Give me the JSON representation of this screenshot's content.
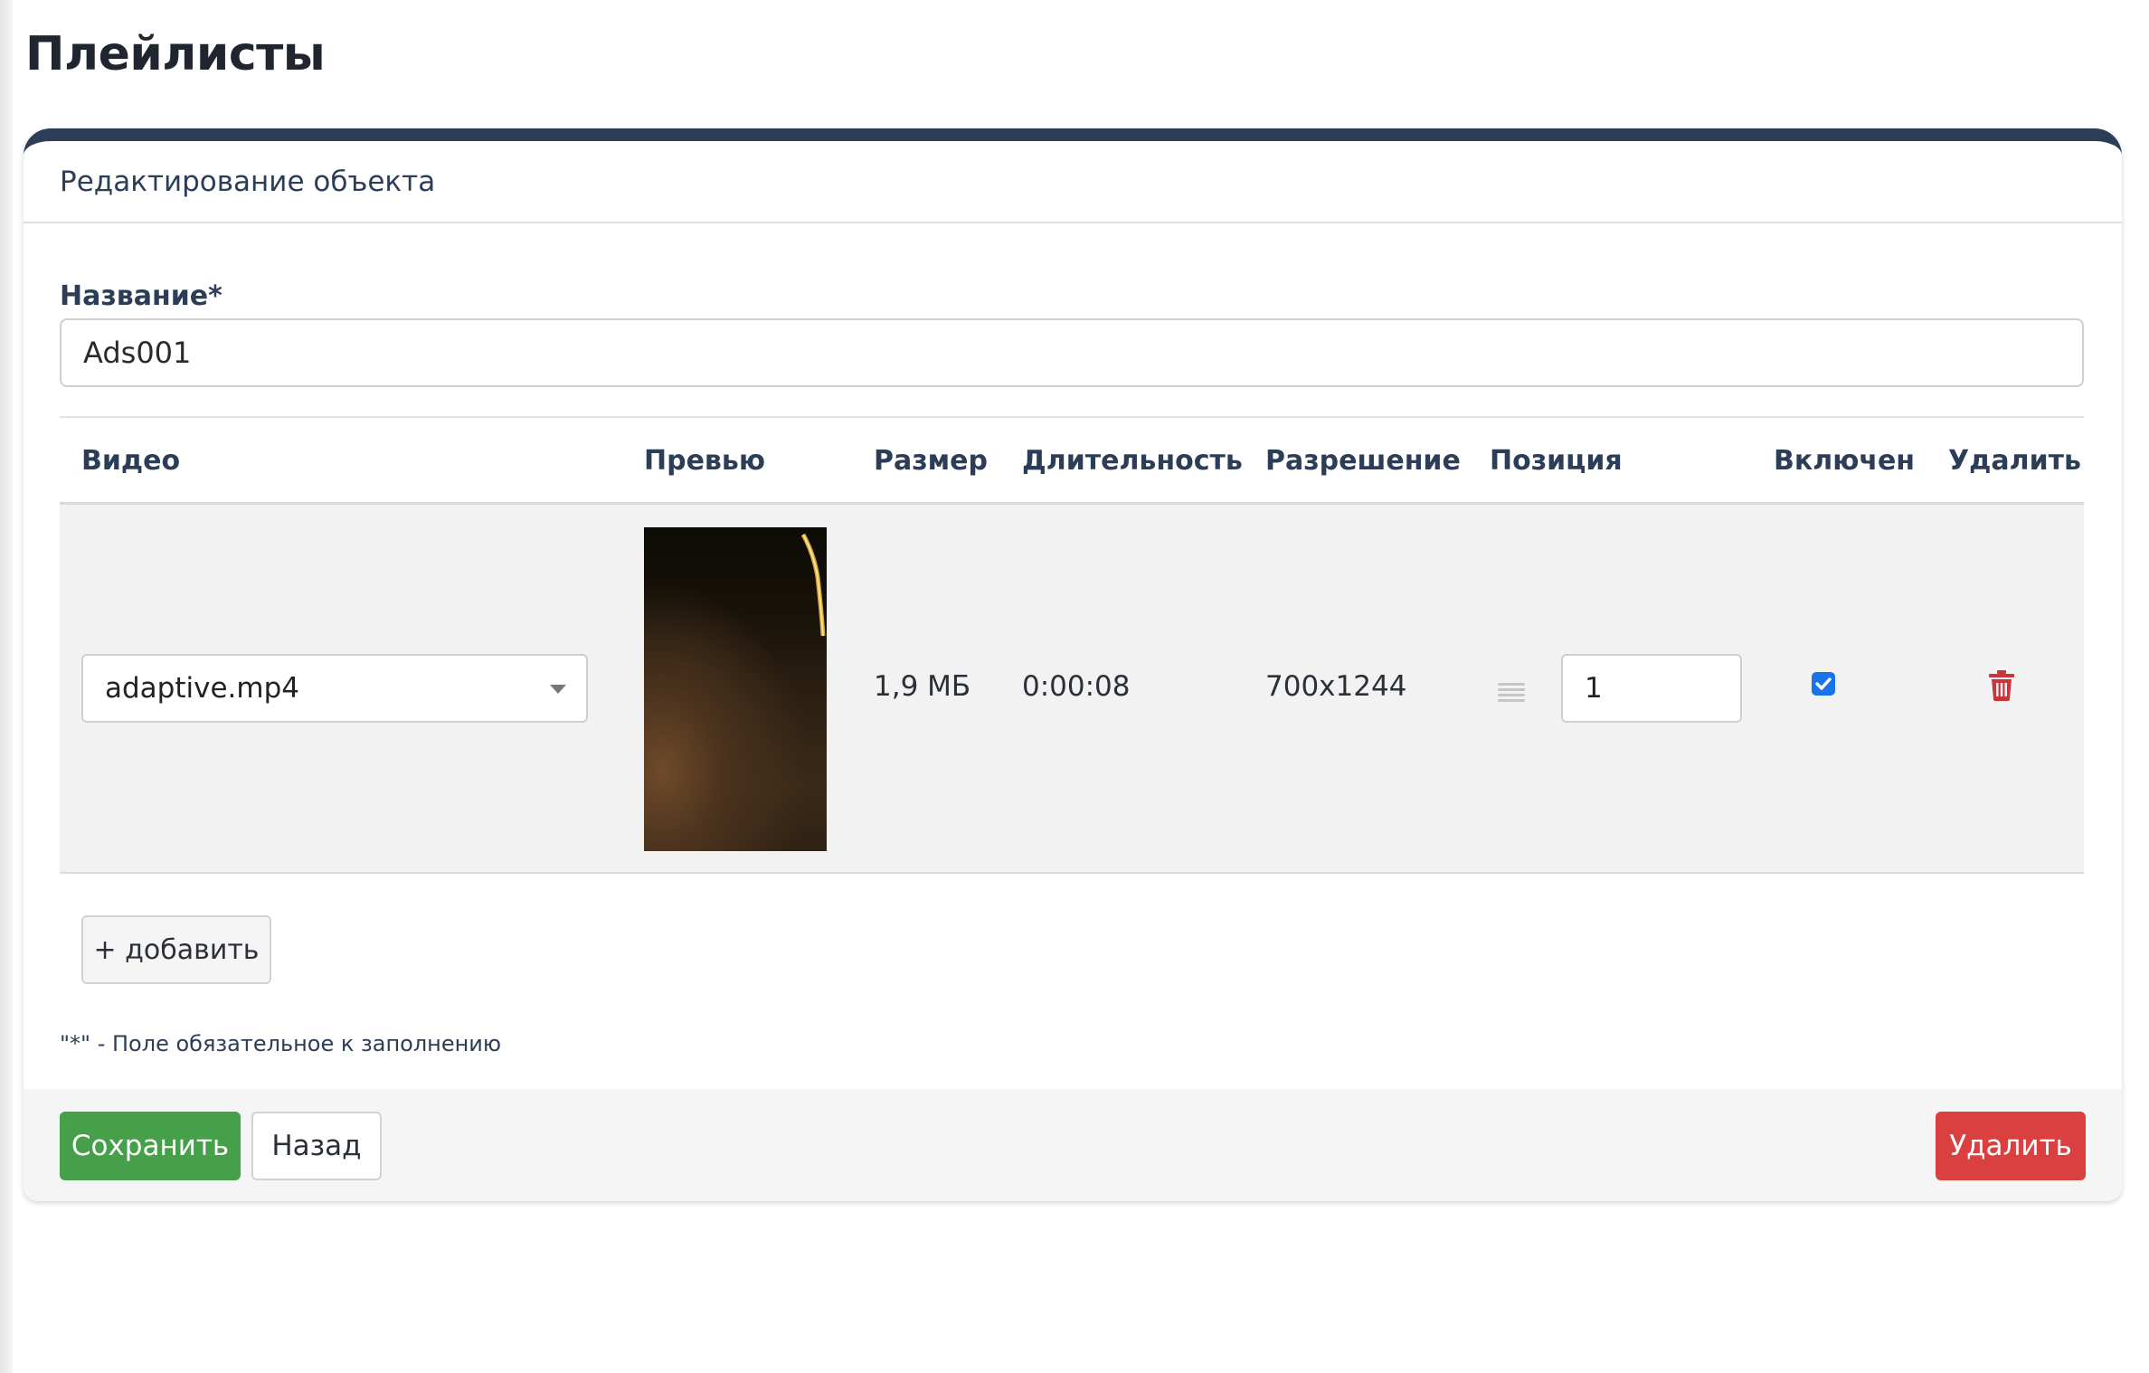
{
  "page": {
    "title": "Плейлисты"
  },
  "card": {
    "header": "Редактирование объекта"
  },
  "form": {
    "name_label": "Название*",
    "name_value": "Ads001"
  },
  "table": {
    "headers": {
      "video": "Видео",
      "preview": "Превью",
      "size": "Размер",
      "duration": "Длительность",
      "resolution": "Разрешение",
      "position": "Позиция",
      "enabled": "Включен",
      "delete": "Удалить"
    },
    "rows": [
      {
        "video": "adaptive.mp4",
        "size": "1,9 МБ",
        "duration": "0:00:08",
        "resolution": "700x1244",
        "position": "1",
        "enabled": true
      }
    ]
  },
  "add_button": "+ добавить",
  "required_note": "\"*\" - Поле обязательное к заполнению",
  "footer": {
    "save": "Сохранить",
    "back": "Назад",
    "delete": "Удалить"
  },
  "colors": {
    "accent_header": "#2c3e57",
    "save": "#45a049",
    "delete": "#d9403f",
    "checkbox": "#1a73e8",
    "trash": "#c9353a"
  }
}
